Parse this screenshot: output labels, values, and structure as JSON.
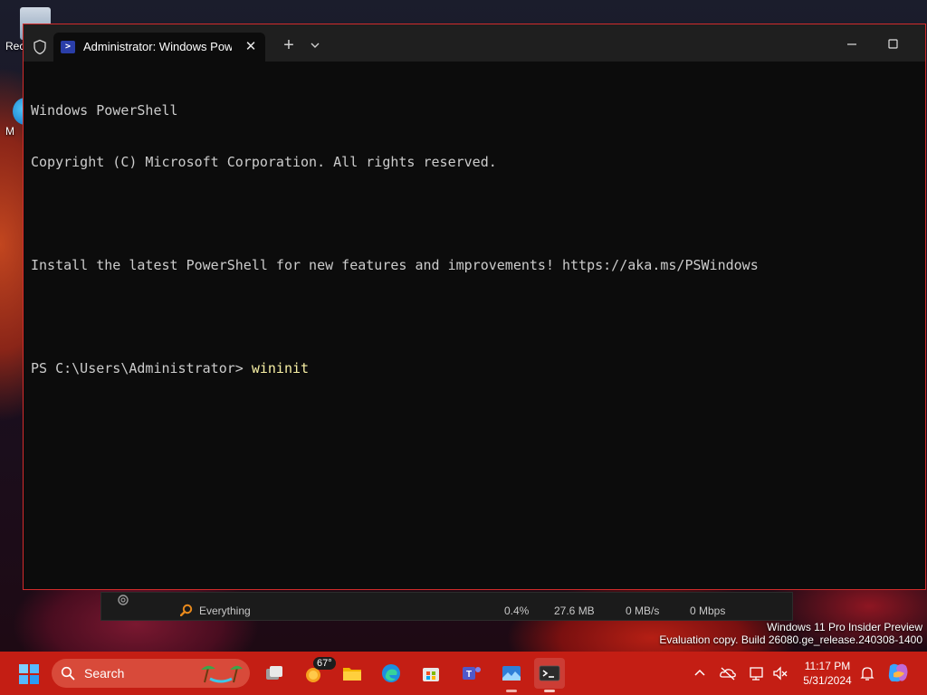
{
  "desktop": {
    "icons": [
      {
        "label": "Rec"
      },
      {
        "label": "M"
      }
    ]
  },
  "terminal": {
    "tab_title": "Administrator: Windows PowerShell",
    "tab_close": "✕",
    "new_tab": "+",
    "lines": [
      "Windows PowerShell",
      "Copyright (C) Microsoft Corporation. All rights reserved.",
      "",
      "Install the latest PowerShell for new features and improvements! https://aka.ms/PSWindows",
      ""
    ],
    "prompt": "PS C:\\Users\\Administrator> ",
    "command": "wininit"
  },
  "everything_bar": {
    "search_label": "Everything",
    "cpu": "0.4%",
    "memory": "27.6 MB",
    "disk": "0 MB/s",
    "network": "0 Mbps"
  },
  "watermark": {
    "line1": "Windows 11 Pro Insider Preview",
    "line2": "Evaluation copy. Build 26080.ge_release.240308-1400"
  },
  "taskbar": {
    "search_placeholder": "Search",
    "weather_temp": "67°",
    "apps": [
      "task-view",
      "weather",
      "file-explorer",
      "edge",
      "microsoft-store",
      "teams",
      "photos",
      "terminal"
    ],
    "clock_time": "11:17 PM",
    "clock_date": "5/31/2024",
    "accent": "#c41e14"
  }
}
